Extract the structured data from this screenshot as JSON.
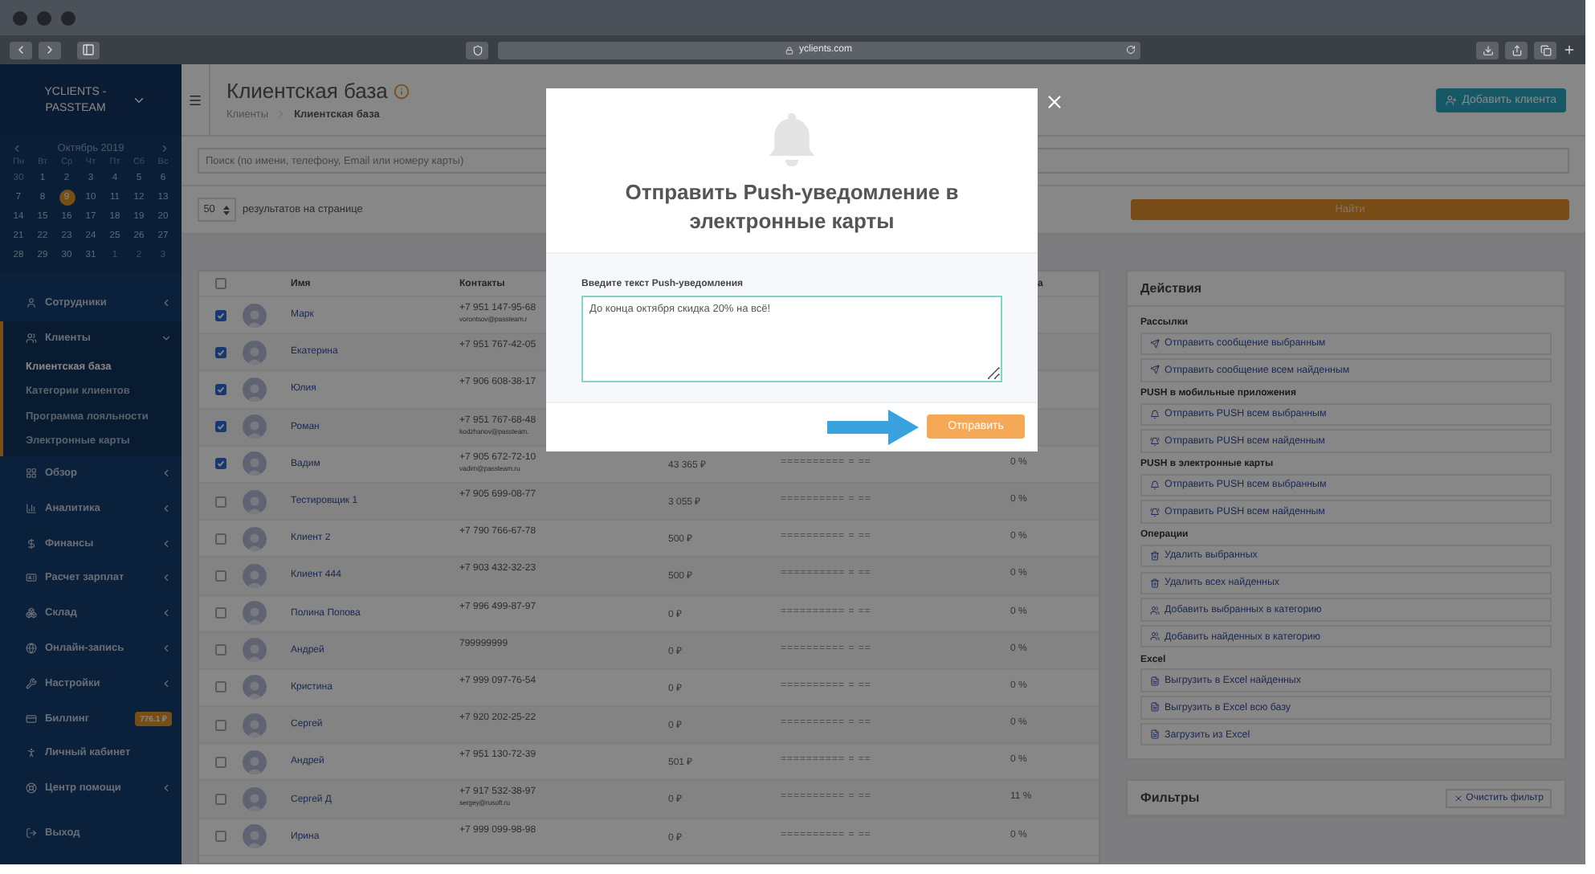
{
  "browser": {
    "url": "yclients.com"
  },
  "sidebar": {
    "company": "YCLIENTS - PASSTEAM",
    "calendar": {
      "month": "Октябрь 2019",
      "weekdays": [
        "Пн",
        "Вт",
        "Ср",
        "Чт",
        "Пт",
        "Сб",
        "Вс"
      ],
      "weeks": [
        [
          {
            "day": "30",
            "in_month": false,
            "selected": false
          },
          {
            "day": "1",
            "in_month": true,
            "selected": false
          },
          {
            "day": "2",
            "in_month": true,
            "selected": false
          },
          {
            "day": "3",
            "in_month": true,
            "selected": false
          },
          {
            "day": "4",
            "in_month": true,
            "selected": false
          },
          {
            "day": "5",
            "in_month": true,
            "selected": false
          },
          {
            "day": "6",
            "in_month": true,
            "selected": false
          }
        ],
        [
          {
            "day": "7",
            "in_month": true,
            "selected": false
          },
          {
            "day": "8",
            "in_month": true,
            "selected": false
          },
          {
            "day": "9",
            "in_month": true,
            "selected": true
          },
          {
            "day": "10",
            "in_month": true,
            "selected": false
          },
          {
            "day": "11",
            "in_month": true,
            "selected": false
          },
          {
            "day": "12",
            "in_month": true,
            "selected": false
          },
          {
            "day": "13",
            "in_month": true,
            "selected": false
          }
        ],
        [
          {
            "day": "14",
            "in_month": true,
            "selected": false
          },
          {
            "day": "15",
            "in_month": true,
            "selected": false
          },
          {
            "day": "16",
            "in_month": true,
            "selected": false
          },
          {
            "day": "17",
            "in_month": true,
            "selected": false
          },
          {
            "day": "18",
            "in_month": true,
            "selected": false
          },
          {
            "day": "19",
            "in_month": true,
            "selected": false
          },
          {
            "day": "20",
            "in_month": true,
            "selected": false
          }
        ],
        [
          {
            "day": "21",
            "in_month": true,
            "selected": false
          },
          {
            "day": "22",
            "in_month": true,
            "selected": false
          },
          {
            "day": "23",
            "in_month": true,
            "selected": false
          },
          {
            "day": "24",
            "in_month": true,
            "selected": false
          },
          {
            "day": "25",
            "in_month": true,
            "selected": false
          },
          {
            "day": "26",
            "in_month": true,
            "selected": false
          },
          {
            "day": "27",
            "in_month": true,
            "selected": false
          }
        ],
        [
          {
            "day": "28",
            "in_month": true,
            "selected": false
          },
          {
            "day": "29",
            "in_month": true,
            "selected": false
          },
          {
            "day": "30",
            "in_month": true,
            "selected": false
          },
          {
            "day": "31",
            "in_month": true,
            "selected": false
          },
          {
            "day": "1",
            "in_month": false,
            "selected": false
          },
          {
            "day": "2",
            "in_month": false,
            "selected": false
          },
          {
            "day": "3",
            "in_month": false,
            "selected": false
          }
        ]
      ]
    },
    "menu": [
      {
        "label": "Сотрудники",
        "kind": "group",
        "expanded": false,
        "selected": false
      },
      {
        "label": "Клиенты",
        "kind": "group",
        "expanded": true,
        "selected": true,
        "children": [
          {
            "label": "Клиентская база",
            "selected": true
          },
          {
            "label": "Категории клиентов",
            "selected": false
          },
          {
            "label": "Программа лояльности",
            "selected": false
          },
          {
            "label": "Электронные карты",
            "selected": false
          }
        ]
      },
      {
        "label": "Обзор",
        "kind": "group",
        "expanded": false,
        "selected": false
      },
      {
        "label": "Аналитика",
        "kind": "group",
        "expanded": false,
        "selected": false
      },
      {
        "label": "Финансы",
        "kind": "group",
        "expanded": false,
        "selected": false
      },
      {
        "label": "Расчет зарплат",
        "kind": "group",
        "expanded": false,
        "selected": false
      },
      {
        "label": "Склад",
        "kind": "group",
        "expanded": false,
        "selected": false
      },
      {
        "label": "Онлайн-запись",
        "kind": "group",
        "expanded": false,
        "selected": false
      },
      {
        "label": "Настройки",
        "kind": "group",
        "expanded": false,
        "selected": false
      },
      {
        "label": "Биллинг",
        "kind": "link",
        "badge": "776.1 ₽",
        "selected": false
      },
      {
        "label": "Личный кабинет",
        "kind": "link",
        "selected": false
      },
      {
        "label": "Центр помощи",
        "kind": "group",
        "expanded": false,
        "selected": false
      },
      {
        "label": "Выход",
        "kind": "link",
        "selected": false
      }
    ]
  },
  "header": {
    "title": "Клиентская база",
    "breadcrumbs": [
      "Клиенты",
      "Клиентская база"
    ],
    "add_button": "Добавить клиента"
  },
  "search": {
    "placeholder": "Поиск (по имени, телефону, Email или номеру карты)"
  },
  "paging": {
    "per_page": "50",
    "label": "результатов на странице"
  },
  "find_button": "Найти",
  "table": {
    "header_checked": false,
    "columns": [
      "Имя",
      "Контакты"
    ],
    "column_5": "а",
    "rows": [
      {
        "checked": true,
        "name": "Марк",
        "phone": "+7 951 147-95-68",
        "email": "vorontsov@passteam.r"
      },
      {
        "checked": true,
        "name": "Екатерина",
        "phone": "+7 951 767-42-05"
      },
      {
        "checked": true,
        "name": "Юлия",
        "phone": "+7 906 608-38-17"
      },
      {
        "checked": true,
        "name": "Роман",
        "phone": "+7 951 767-68-48",
        "email": "kodzhanov@passteam."
      },
      {
        "checked": true,
        "name": "Вадим",
        "phone": "+7 905 672-72-10",
        "email": "vadim@passteam.ru",
        "amount": "43 365 ₽",
        "card": "========== = ==",
        "percent": "0 %"
      },
      {
        "checked": false,
        "name": "Тестировщик 1",
        "phone": "+7 905 699-08-77",
        "amount": "3 055 ₽",
        "card": "========== = ==",
        "percent": "0 %"
      },
      {
        "checked": false,
        "name": "Клиент 2",
        "phone": "+7 790 766-67-78",
        "amount": "500 ₽",
        "card": "========== = ==",
        "percent": "0 %"
      },
      {
        "checked": false,
        "name": "Клиент 444",
        "phone": "+7 903 432-32-23",
        "amount": "500 ₽",
        "card": "========== = ==",
        "percent": "0 %"
      },
      {
        "checked": false,
        "name": "Полина Попова",
        "phone": "+7 996 499-87-97",
        "amount": "0 ₽",
        "card": "========== = ==",
        "percent": "0 %"
      },
      {
        "checked": false,
        "name": "Андрей",
        "phone": "799999999",
        "amount": "0 ₽",
        "card": "========== = ==",
        "percent": "0 %"
      },
      {
        "checked": false,
        "name": "Кристина",
        "phone": "+7 999 097-76-54",
        "amount": "0 ₽",
        "card": "========== = ==",
        "percent": "0 %"
      },
      {
        "checked": false,
        "name": "Сергей",
        "phone": "+7 920 202-25-22",
        "amount": "0 ₽",
        "card": "========== = ==",
        "percent": "0 %"
      },
      {
        "checked": false,
        "name": "Андрей",
        "phone": "+7 951 130-72-39",
        "amount": "501 ₽",
        "card": "========== = ==",
        "percent": "0 %"
      },
      {
        "checked": false,
        "name": "Сергей Д",
        "phone": "+7 917 532-38-97",
        "email": "sergey@rusoft.ru",
        "amount": "0 ₽",
        "card": "========== = ==",
        "percent": "11 %"
      },
      {
        "checked": false,
        "name": "Ирина",
        "phone": "+7 999 099-98-98",
        "amount": "0 ₽",
        "card": "========== = ==",
        "percent": "0 %"
      }
    ]
  },
  "actions": {
    "title": "Действия",
    "groups": [
      {
        "title": "Рассылки",
        "items": [
          "Отправить сообщение выбранным",
          "Отправить сообщение всем найденным"
        ]
      },
      {
        "title": "PUSH в мобильные приложения",
        "items": [
          "Отправить PUSH всем выбранным",
          "Отправить PUSH всем найденным"
        ]
      },
      {
        "title": "PUSH в электронные карты",
        "items": [
          "Отправить PUSH всем выбранным",
          "Отправить PUSH всем найденным"
        ]
      },
      {
        "title": "Операции",
        "items": [
          "Удалить выбранных",
          "Удалить всех найденных",
          "Добавить выбранных в категорию",
          "Добавить найденных в категорию"
        ]
      },
      {
        "title": "Excel",
        "items": [
          "Выгрузить в Excel найденных",
          "Выгрузить в Excel всю базу",
          "Загрузить из Excel"
        ]
      }
    ]
  },
  "filters": {
    "title": "Фильтры",
    "clear_button": "Очистить фильтр"
  },
  "modal": {
    "title": "Отправить Push-уведомление в электронные карты",
    "label": "Введите текст Push-уведомления",
    "message": "До конца октября скидка 20% на всё!",
    "send_button": "Отправить"
  }
}
